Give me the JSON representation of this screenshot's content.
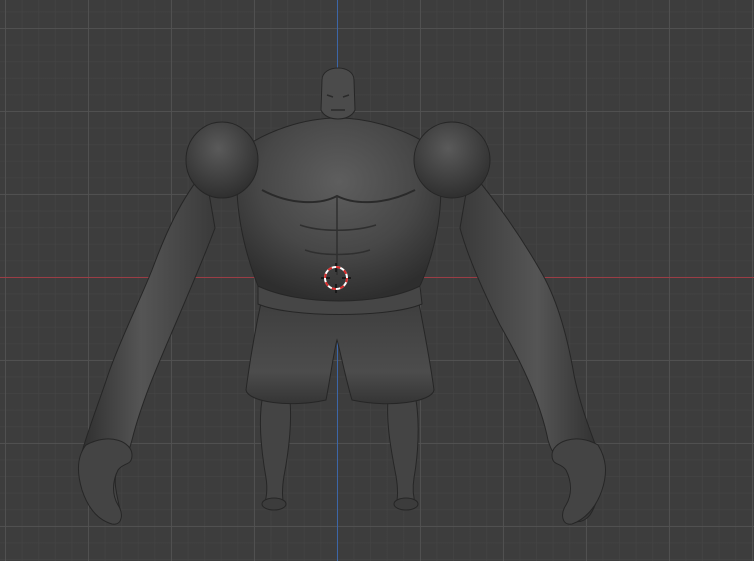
{
  "viewport": {
    "background_color": "#3d3d3d",
    "grid": true,
    "x_axis_color": "#9b3d45",
    "y_axis_color": "#3c66a8"
  },
  "model": {
    "name": "muscular-character-sculpt",
    "base_color": "#4a4a4a",
    "shadow_color": "#262626",
    "highlight_color": "#6a6a6a"
  },
  "cursor": {
    "icon": "3d-cursor-icon",
    "ring_color_a": "#d92b2b",
    "ring_color_b": "#ffffff"
  }
}
